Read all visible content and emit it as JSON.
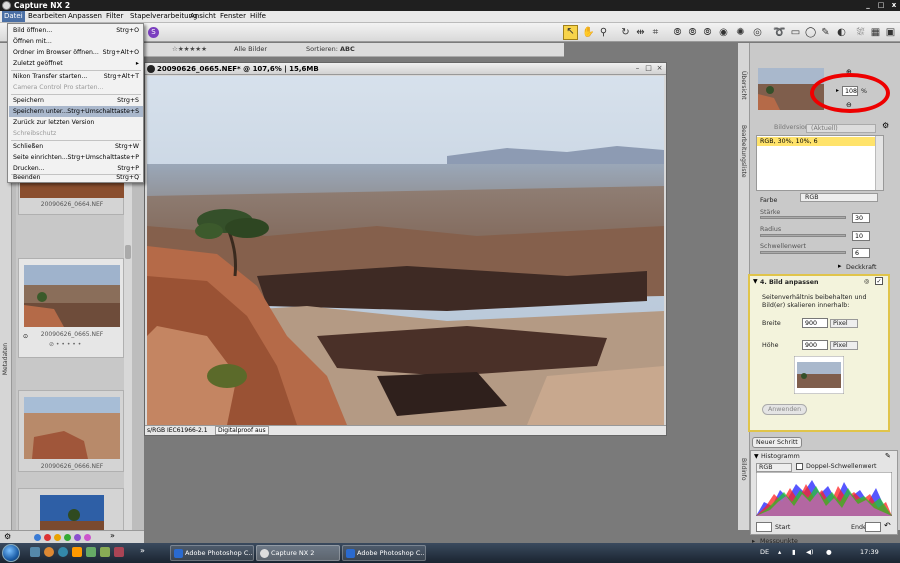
{
  "app": {
    "title": "Capture NX 2"
  },
  "window_controls": {
    "minimize": "_",
    "maximize": "□",
    "close": "x"
  },
  "menu": [
    {
      "label": "Datei"
    },
    {
      "label": "Bearbeiten"
    },
    {
      "label": "Anpassen"
    },
    {
      "label": "Filter"
    },
    {
      "label": "Stapelverarbeitung"
    },
    {
      "label": "Ansicht"
    },
    {
      "label": "Fenster"
    },
    {
      "label": "Hilfe"
    }
  ],
  "file_menu": [
    {
      "label": "Bild öffnen...",
      "shortcut": "Strg+O"
    },
    {
      "label": "Öffnen mit...",
      "shortcut": ""
    },
    {
      "label": "Ordner im Browser öffnen...",
      "shortcut": "Strg+Alt+O"
    },
    {
      "label": "Zuletzt geöffnet",
      "shortcut": "▸"
    },
    {
      "label": "Nikon Transfer starten...",
      "shortcut": "Strg+Alt+T"
    },
    {
      "label": "Camera Control Pro starten...",
      "shortcut": ""
    },
    {
      "label": "Speichern",
      "shortcut": "Strg+S"
    },
    {
      "label": "Speichern unter...",
      "shortcut": "Strg+Umschalttaste+S"
    },
    {
      "label": "Zurück zur letzten Version",
      "shortcut": ""
    },
    {
      "label": "Schreibschutz",
      "shortcut": ""
    },
    {
      "label": "Schließen",
      "shortcut": "Strg+W"
    },
    {
      "label": "Seite einrichten...",
      "shortcut": "Strg+Umschalttaste+P"
    },
    {
      "label": "Drucken...",
      "shortcut": "Strg+P"
    },
    {
      "label": "Beenden",
      "shortcut": "Strg+Q"
    }
  ],
  "browser_toolbar": {
    "rating": "☆★★★★★",
    "filter": "Alle Bilder",
    "sort_label": "Sortieren:",
    "sort_value": "ABC"
  },
  "thumbnails": [
    {
      "name": "20090626_0664.NEF"
    },
    {
      "name": "20090626_0665.NEF"
    },
    {
      "name": "20090626_0666.NEF"
    }
  ],
  "document": {
    "title": "20090626_0665.NEF* @ 107,6% | 15,6MB",
    "color_profile": "s/RGB IEC61966-2.1",
    "proof": "Digitalproof aus"
  },
  "side_labels": {
    "left": "Metadaten",
    "right_top": "Übersicht",
    "right_mid": "Bearbeitungsliste",
    "right_bottom": "Bildinfo"
  },
  "overview": {
    "zoom_value": "108",
    "zoom_unit": "%"
  },
  "edit_list": {
    "version_label": "Bildversion",
    "version_value": "(Aktuell)",
    "unsharp_entry": "RGB, 30%, 10%, 6",
    "channel": "RGB",
    "color_label": "Farbe",
    "strength_label": "Stärke",
    "strength_value": "30",
    "radius_label": "Radius",
    "radius_value": "10",
    "threshold_label": "Schwellenwert",
    "threshold_value": "6",
    "opacity_label": "Deckkraft",
    "step_title": "4. Bild anpassen",
    "aspect_text": "Seitenverhältnis beibehalten und Bild(er) skalieren innerhalb:",
    "width_label": "Breite",
    "width_value": "900",
    "height_label": "Höhe",
    "height_value": "900",
    "unit": "Pixel",
    "apply_button": "Anwenden",
    "new_step_button": "Neuer Schritt"
  },
  "histogram": {
    "title": "Histogramm",
    "channel": "RGB",
    "double_threshold": "Doppel-Schwellenwert",
    "start_label": "Start",
    "end_label": "Ende"
  },
  "focus_points": "Messpunkte",
  "taskbar": {
    "tasks": [
      {
        "label": "Adobe Photoshop C..."
      },
      {
        "label": "Capture NX 2"
      },
      {
        "label": "Adobe Photoshop C..."
      }
    ],
    "lang": "DE",
    "time": "17:39"
  },
  "colors": {
    "accent_highlight": "#f7d34a",
    "annotation_circle": "#e00000",
    "menu_active": "#4a6fa5"
  }
}
